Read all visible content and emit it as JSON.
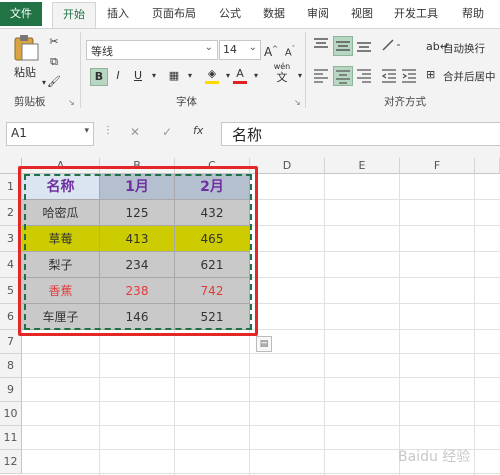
{
  "ribbon_tabs": [
    "文件",
    "开始",
    "插入",
    "页面布局",
    "公式",
    "数据",
    "审阅",
    "视图",
    "开发工具",
    "帮助"
  ],
  "clipboard": {
    "paste_label": "粘贴",
    "group_label": "剪贴板"
  },
  "font": {
    "name": "等线",
    "size": "14",
    "grow": "A",
    "shrink": "A",
    "bold": "B",
    "italic": "I",
    "underline": "U",
    "font_color_letter": "A",
    "wen": "wén",
    "wen_char": "文",
    "group_label": "字体"
  },
  "alignment": {
    "wrap_label": "自动换行",
    "merge_label": "合并后居中",
    "group_label": "对齐方式"
  },
  "formula_bar": {
    "cell_ref": "A1",
    "fx": "fx",
    "cancel": "✕",
    "enter": "✓",
    "value": "名称"
  },
  "columns": [
    "A",
    "B",
    "C",
    "D",
    "E",
    "F"
  ],
  "rows": [
    "1",
    "2",
    "3",
    "4",
    "5",
    "6",
    "7",
    "8",
    "9",
    "10",
    "11",
    "12"
  ],
  "table": [
    [
      "名称",
      "1月",
      "2月"
    ],
    [
      "哈密瓜",
      "125",
      "432"
    ],
    [
      "草莓",
      "413",
      "465"
    ],
    [
      "梨子",
      "234",
      "621"
    ],
    [
      "香蕉",
      "238",
      "742"
    ],
    [
      "车厘子",
      "146",
      "521"
    ]
  ],
  "colors": {
    "accent": "#217346",
    "header_fill": "#dbe5f1",
    "header_text": "#7030a0",
    "gray_fill": "#c9c9c9",
    "yellow_fill": "#cccc00",
    "red_text": "#e03b3b",
    "selection_border": "#e32626"
  },
  "watermark": "Baidu 经验"
}
